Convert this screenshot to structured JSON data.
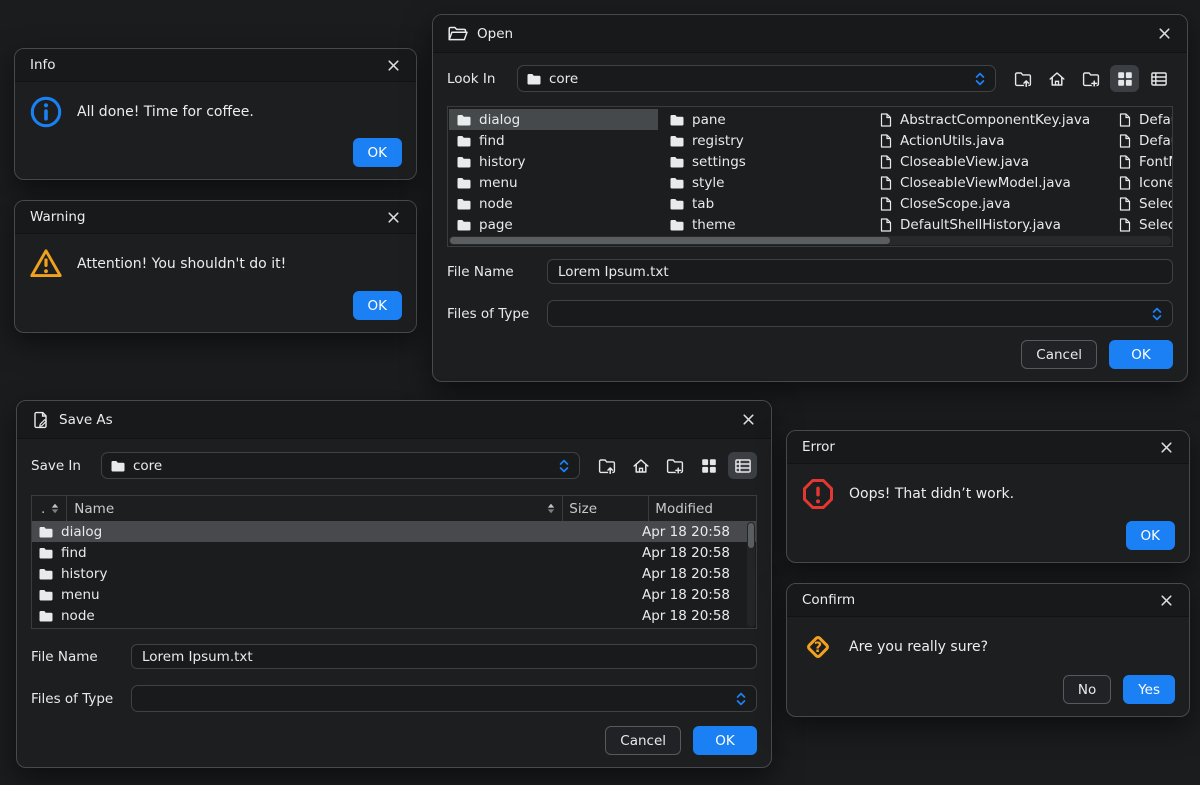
{
  "colors": {
    "background": "#1b1c1e",
    "accent_blue": "#1b80f4",
    "warning_orange": "#f2a11f",
    "error_red": "#e53731",
    "selection_gray": "#46494c"
  },
  "icons": {
    "close": "✕",
    "folder": "filled folder glyph",
    "file": "document outline glyph",
    "combo_chevrons": "blue up/down chevrons",
    "sort": "up/down triangles",
    "toolbar": [
      "folder-up",
      "home",
      "new-folder",
      "grid-view",
      "details-view"
    ]
  },
  "info": {
    "title": "Info",
    "message": "All done! Time for coffee.",
    "ok_label": "OK"
  },
  "warning": {
    "title": "Warning",
    "message": "Attention! You shouldn't do it!",
    "ok_label": "OK"
  },
  "error": {
    "title": "Error",
    "message": "Oops! That didn’t work.",
    "ok_label": "OK"
  },
  "confirm": {
    "title": "Confirm",
    "message": "Are you really sure?",
    "no_label": "No",
    "yes_label": "Yes"
  },
  "open": {
    "title": "Open",
    "look_in_label": "Look In",
    "location": "core",
    "selected_item": "dialog",
    "folders_col1": [
      "dialog",
      "find",
      "history",
      "menu",
      "node",
      "page"
    ],
    "folders_col2": [
      "pane",
      "registry",
      "settings",
      "style",
      "tab",
      "theme"
    ],
    "files_col3": [
      "AbstractComponentKey.java",
      "ActionUtils.java",
      "CloseableView.java",
      "CloseableViewModel.java",
      "CloseScope.java",
      "DefaultShellHistory.java"
    ],
    "files_col4": [
      "DefaultS",
      "DefaultS",
      "FontMan",
      "IconedVi",
      "Selectab",
      "Selectab"
    ],
    "file_name_label": "File Name",
    "file_name_value": "Lorem Ipsum.txt",
    "files_of_type_label": "Files of Type",
    "files_of_type_value": "",
    "cancel_label": "Cancel",
    "ok_label": "OK"
  },
  "save": {
    "title": "Save As",
    "save_in_label": "Save In",
    "location": "core",
    "table": {
      "columns": [
        ".",
        "Name",
        "Size",
        "Modified"
      ],
      "rows": [
        {
          "name": "dialog",
          "size": "",
          "modified": "Apr 18 20:58",
          "selected": true
        },
        {
          "name": "find",
          "size": "",
          "modified": "Apr 18 20:58",
          "selected": false
        },
        {
          "name": "history",
          "size": "",
          "modified": "Apr 18 20:58",
          "selected": false
        },
        {
          "name": "menu",
          "size": "",
          "modified": "Apr 18 20:58",
          "selected": false
        },
        {
          "name": "node",
          "size": "",
          "modified": "Apr 18 20:58",
          "selected": false
        }
      ]
    },
    "file_name_label": "File Name",
    "file_name_value": "Lorem Ipsum.txt",
    "files_of_type_label": "Files of Type",
    "files_of_type_value": "",
    "cancel_label": "Cancel",
    "ok_label": "OK"
  }
}
